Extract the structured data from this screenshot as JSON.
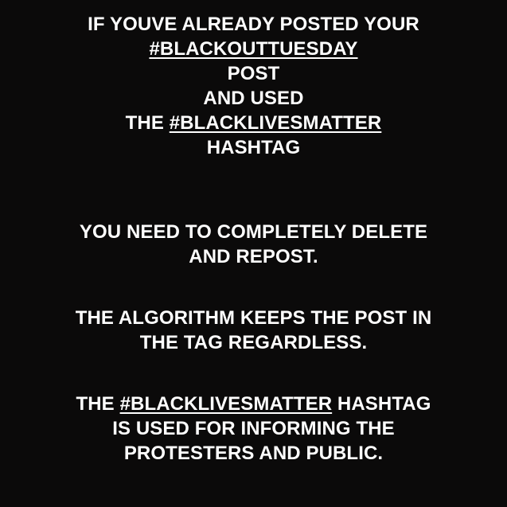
{
  "block_1": {
    "line_1": "IF YOUVE ALREADY POSTED YOUR",
    "line_2_tag": "#BLACKOUTTUESDAY",
    "line_3": "POST",
    "line_4": "AND USED",
    "line_5_prefix": "THE ",
    "line_5_tag": "#BLACKLIVESMATTER",
    "line_6": "HASHTAG"
  },
  "block_2": {
    "line_1": "YOU NEED TO COMPLETELY DELETE",
    "line_2": "AND REPOST."
  },
  "block_3": {
    "line_1": "THE ALGORITHM KEEPS THE POST IN",
    "line_2": "THE TAG REGARDLESS."
  },
  "block_4": {
    "line_1_prefix": "THE ",
    "line_1_tag": "#BLACKLIVESMATTER",
    "line_1_suffix": " HASHTAG",
    "line_2": "IS USED FOR INFORMING THE",
    "line_3": "PROTESTERS AND PUBLIC."
  },
  "colors": {
    "background": "#0b0a0a",
    "text": "#ffffff"
  }
}
